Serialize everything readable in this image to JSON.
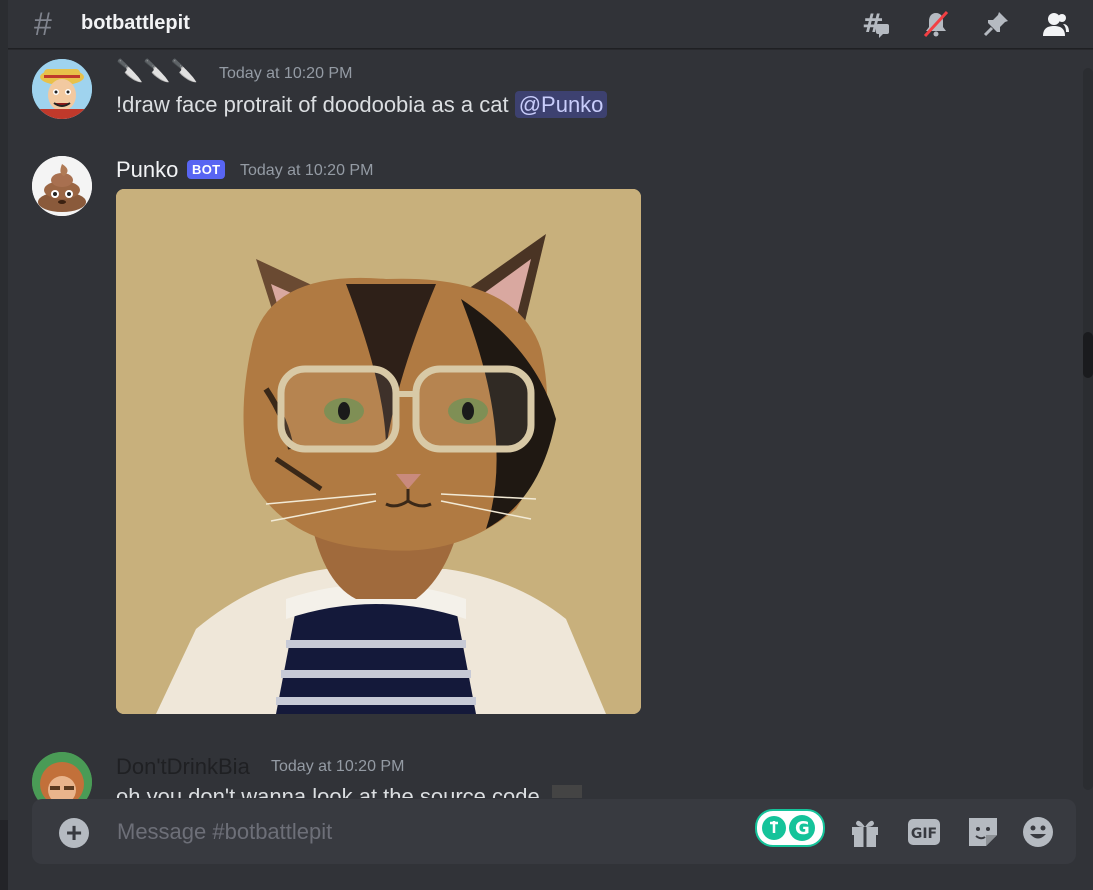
{
  "channel": {
    "name": "botbattlepit",
    "icons": [
      "threads-icon",
      "notifications-muted-icon",
      "pin-icon",
      "member-list-icon"
    ]
  },
  "messages": [
    {
      "author": "🔪🔪🔪",
      "timestamp": "Today at 10:20 PM",
      "text": "!draw face protrait of doodoobia as a cat",
      "mention": "@Punko"
    },
    {
      "author": "Punko",
      "badge": "BOT",
      "timestamp": "Today at 10:20 PM",
      "attachment": "cat-portrait-image"
    },
    {
      "author": "Don'tDrinkBia",
      "timestamp": "Today at 10:20 PM",
      "text": "oh you don't wanna look at the source code"
    }
  ],
  "composer": {
    "placeholder": "Message #botbattlepit",
    "gif_label": "GIF"
  },
  "colors": {
    "background": "#313338",
    "accent": "#5865f2",
    "grammarly": "#15c39a"
  }
}
